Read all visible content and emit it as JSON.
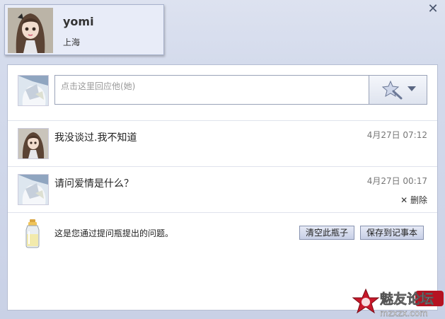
{
  "header": {
    "name": "yomi",
    "city": "上海"
  },
  "reply": {
    "placeholder": "点击这里回应他(她)"
  },
  "messages": [
    {
      "text": "我没谈过.我不知道",
      "time": "4月27日 07:12"
    },
    {
      "text": "请问爱情是什么？",
      "time": "4月27日 00:17",
      "delete_label": "删除"
    }
  ],
  "footer": {
    "note": "这是您通过提问瓶提出的问题。",
    "clear_button": "清空此瓶子",
    "save_button": "保存到记事本"
  },
  "watermark": {
    "logo_text": "魅友论坛",
    "url_text": "mzxzx.com"
  },
  "colors": {
    "panel_bg": "#ffffff",
    "window_bg": "#d4dbec",
    "button_bg": "#c7cfe6"
  }
}
